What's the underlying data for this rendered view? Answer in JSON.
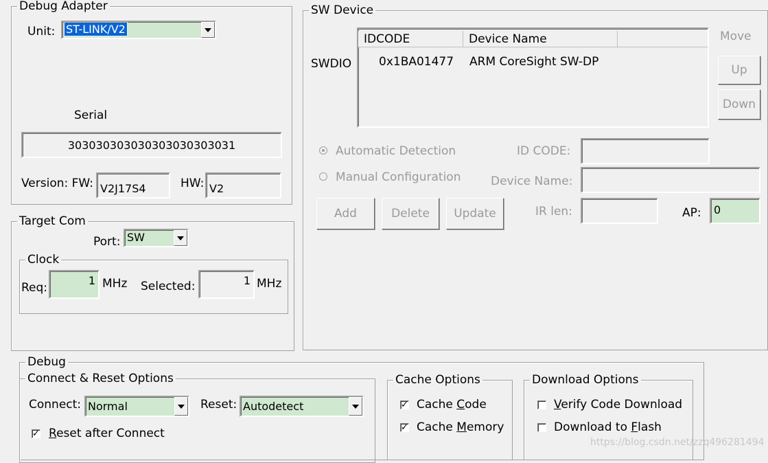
{
  "debug_adapter": {
    "legend": "Debug Adapter",
    "unit_label": "Unit:",
    "unit_value": "ST-LINK/V2",
    "serial_label": "Serial",
    "serial_value": "303030303030303030303031",
    "version_label": "Version: FW:",
    "fw_value": "V2J17S4",
    "hw_label": "HW:",
    "hw_value": "V2"
  },
  "target_com": {
    "legend": "Target Com",
    "port_label": "Port:",
    "port_value": "SW",
    "clock": {
      "legend": "Clock",
      "req_label": "Req:",
      "req_value": "1",
      "req_unit": "MHz",
      "selected_label": "Selected:",
      "selected_value": "1",
      "selected_unit": "MHz"
    }
  },
  "sw_device": {
    "legend": "SW Device",
    "row_label": "SWDIO",
    "columns": [
      "IDCODE",
      "Device Name"
    ],
    "rows": [
      {
        "idcode": "0x1BA01477",
        "device_name": "ARM CoreSight SW-DP"
      }
    ],
    "move_label": "Move",
    "up_label": "Up",
    "down_label": "Down",
    "auto_detection": "Automatic Detection",
    "manual_config": "Manual Configuration",
    "id_code_label": "ID CODE:",
    "device_name_label": "Device Name:",
    "ir_len_label": "IR len:",
    "ap_label": "AP:",
    "ap_value": "0",
    "add_label": "Add",
    "delete_label": "Delete",
    "update_label": "Update"
  },
  "debug": {
    "legend": "Debug",
    "connect_reset": {
      "legend": "Connect & Reset Options",
      "connect_label": "Connect:",
      "connect_value": "Normal",
      "reset_label": "Reset:",
      "reset_value": "Autodetect",
      "reset_after_connect_prefix": "",
      "reset_after_connect_u": "R",
      "reset_after_connect_rest": "eset after Connect"
    },
    "cache": {
      "legend": "Cache Options",
      "code_a": "Cache ",
      "code_u": "C",
      "code_b": "ode",
      "memory_a": "Cache ",
      "memory_u": "M",
      "memory_b": "emory"
    },
    "download": {
      "legend": "Download Options",
      "verify_u": "V",
      "verify_b": "erify Code Download",
      "flash_a": "Download to ",
      "flash_u": "F",
      "flash_b": "lash"
    }
  },
  "watermark": "https://blog.csdn.net/zzq496281494"
}
